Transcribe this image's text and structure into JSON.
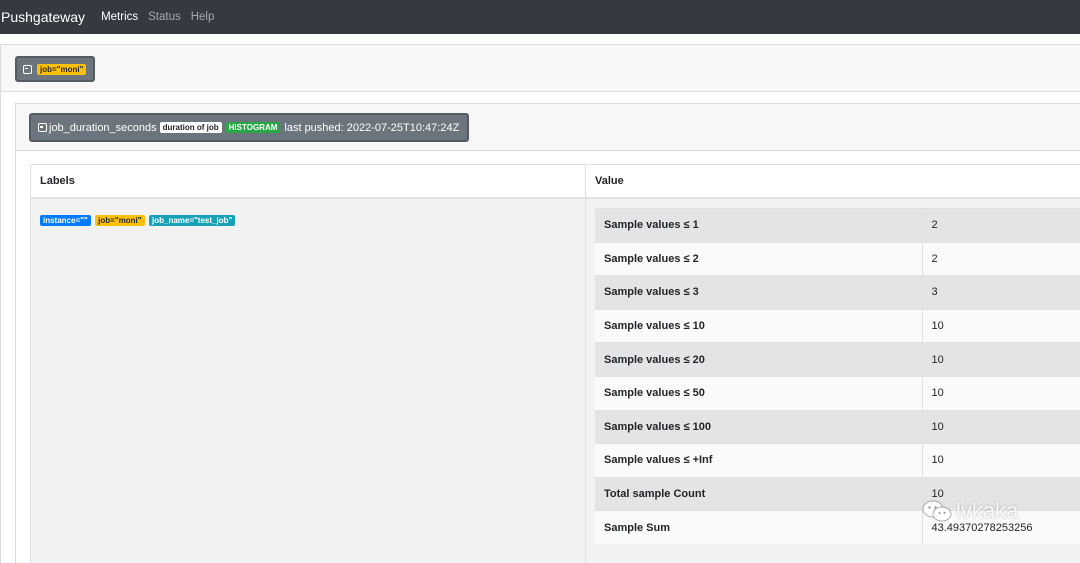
{
  "navbar": {
    "brand": "Pushgateway",
    "links": [
      {
        "label": "Metrics",
        "active": true
      },
      {
        "label": "Status",
        "active": false
      },
      {
        "label": "Help",
        "active": false
      }
    ]
  },
  "group": {
    "label": "job=\"moni\""
  },
  "metric": {
    "name": "job_duration_seconds",
    "help": "duration of job",
    "type": "HISTOGRAM",
    "last_pushed": "last pushed: 2022-07-25T10:47:24Z"
  },
  "table": {
    "headers": {
      "labels": "Labels",
      "value": "Value"
    },
    "labels": [
      {
        "text": "instance=\"\"",
        "color": "#007bff"
      },
      {
        "text": "job=\"moni\"",
        "color": "#ffc107"
      },
      {
        "text": "job_name=\"test_job\"",
        "color": "#17a2b8"
      }
    ],
    "rows": [
      {
        "name": "Sample values ≤ 1",
        "value": "2"
      },
      {
        "name": "Sample values ≤ 2",
        "value": "2"
      },
      {
        "name": "Sample values ≤ 3",
        "value": "3"
      },
      {
        "name": "Sample values ≤ 10",
        "value": "10"
      },
      {
        "name": "Sample values ≤ 20",
        "value": "10"
      },
      {
        "name": "Sample values ≤ 50",
        "value": "10"
      },
      {
        "name": "Sample values ≤ 100",
        "value": "10"
      },
      {
        "name": "Sample values ≤ +Inf",
        "value": "10"
      },
      {
        "name": "Total sample Count",
        "value": "10"
      },
      {
        "name": "Sample Sum",
        "value": "43.49370278253256"
      }
    ]
  },
  "watermark": {
    "text": "lvkaka"
  },
  "colors": {
    "navbar_bg": "#343a40",
    "button_bg": "#6c757d",
    "badge_yellow": "#ffc107",
    "badge_blue": "#007bff",
    "badge_teal": "#17a2b8",
    "badge_green": "#28a745"
  }
}
